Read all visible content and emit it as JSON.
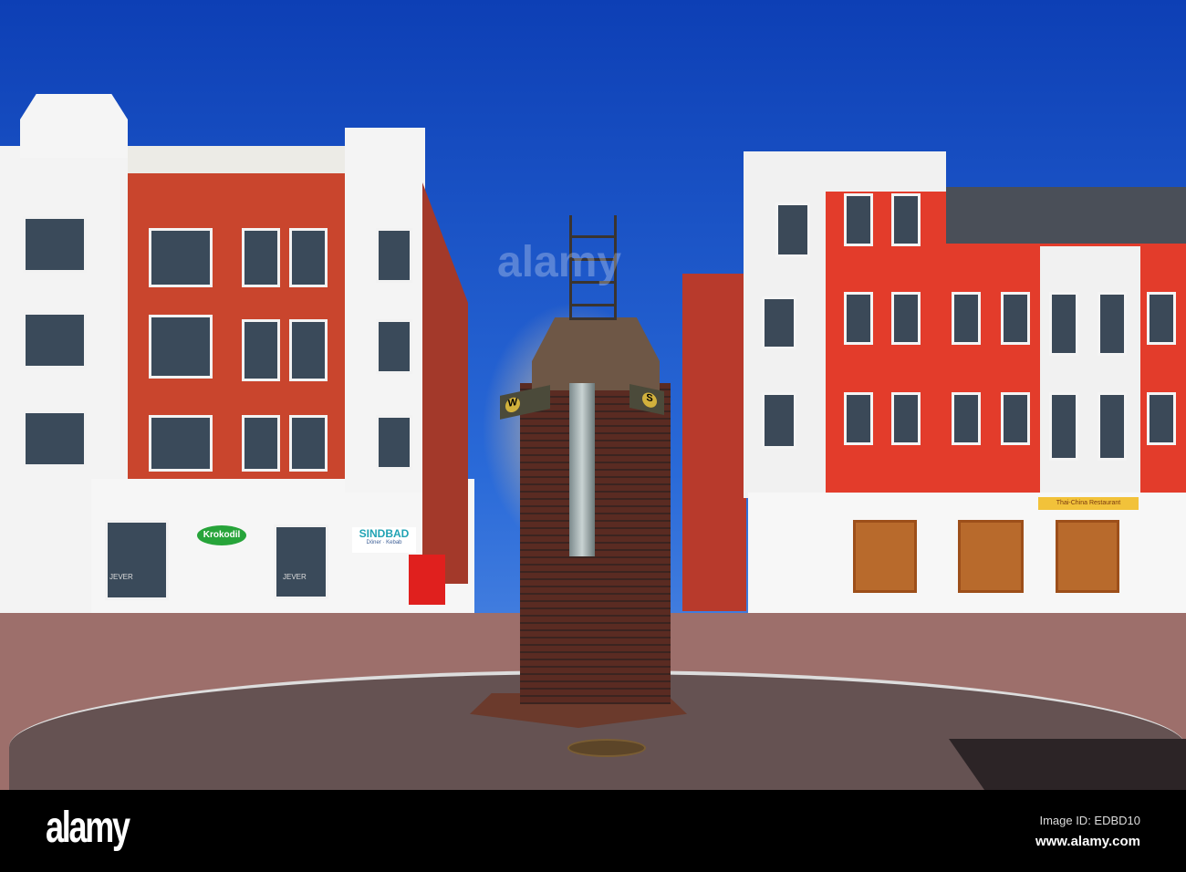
{
  "signs": {
    "krokodil": "Krokodil",
    "sindbad": "SINDBAD",
    "sindbad_sub": "Döner · Kebab",
    "jever": "JEVER",
    "jever2": "JEVER",
    "restaurant": "Thai-China Restaurant"
  },
  "monument": {
    "west": "W",
    "south": "S"
  },
  "watermark": {
    "logo": "alamy",
    "image_id": "Image ID: EDBD10",
    "url": "www.alamy.com"
  },
  "colors": {
    "sky": "#1447bd",
    "brick": "#c9452d",
    "red_facade": "#e23a2a",
    "bar": "#000000"
  }
}
